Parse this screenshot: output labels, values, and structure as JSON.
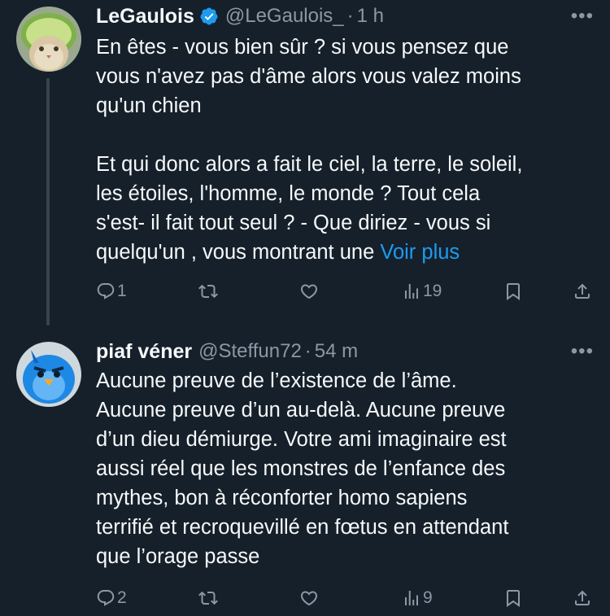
{
  "tweets": [
    {
      "name": "LeGaulois",
      "verified": true,
      "handle": "@LeGaulois_",
      "separator": "·",
      "time": "1 h",
      "more": "•••",
      "paragraphs": [
        "En êtes - vous bien sûr ? si vous pensez que\nvous n'avez pas d'âme alors vous valez moins\nqu'un chien",
        "Et qui donc alors a fait le ciel, la terre, le soleil,\nles étoiles, l'homme, le monde ? Tout cela\ns'est- il fait tout seul ? - Que diriez - vous si\nquelqu'un , vous montrant une "
      ],
      "see_more": "Voir plus",
      "replies": "1",
      "views": "19",
      "avatar_icon": "cat-with-melon-hat-avatar"
    },
    {
      "name": "piaf véner",
      "verified": false,
      "handle": "@Steffun72",
      "separator": "·",
      "time": "54 m",
      "more": "•••",
      "paragraphs": [
        "Aucune preuve de l’existence de l’âme.\nAucune preuve d’un au-delà. Aucune preuve\nd’un dieu démiurge. Votre ami imaginaire est\naussi réel que les monstres de l’enfance des\nmythes, bon à réconforter homo sapiens\nterrifié et recroquevillé en fœtus en attendant\nque l’orage passe"
      ],
      "replies": "2",
      "views": "9",
      "avatar_icon": "angry-blue-bird-avatar"
    }
  ],
  "colors": {
    "background": "#15202b",
    "text": "#f7f9f9",
    "muted": "#8b98a5",
    "link": "#1d9bf0",
    "thread_line": "#38444d"
  },
  "icons": [
    "reply-icon",
    "retweet-icon",
    "like-icon",
    "views-icon",
    "bookmark-icon",
    "share-icon",
    "verified-badge-icon",
    "more-icon"
  ]
}
